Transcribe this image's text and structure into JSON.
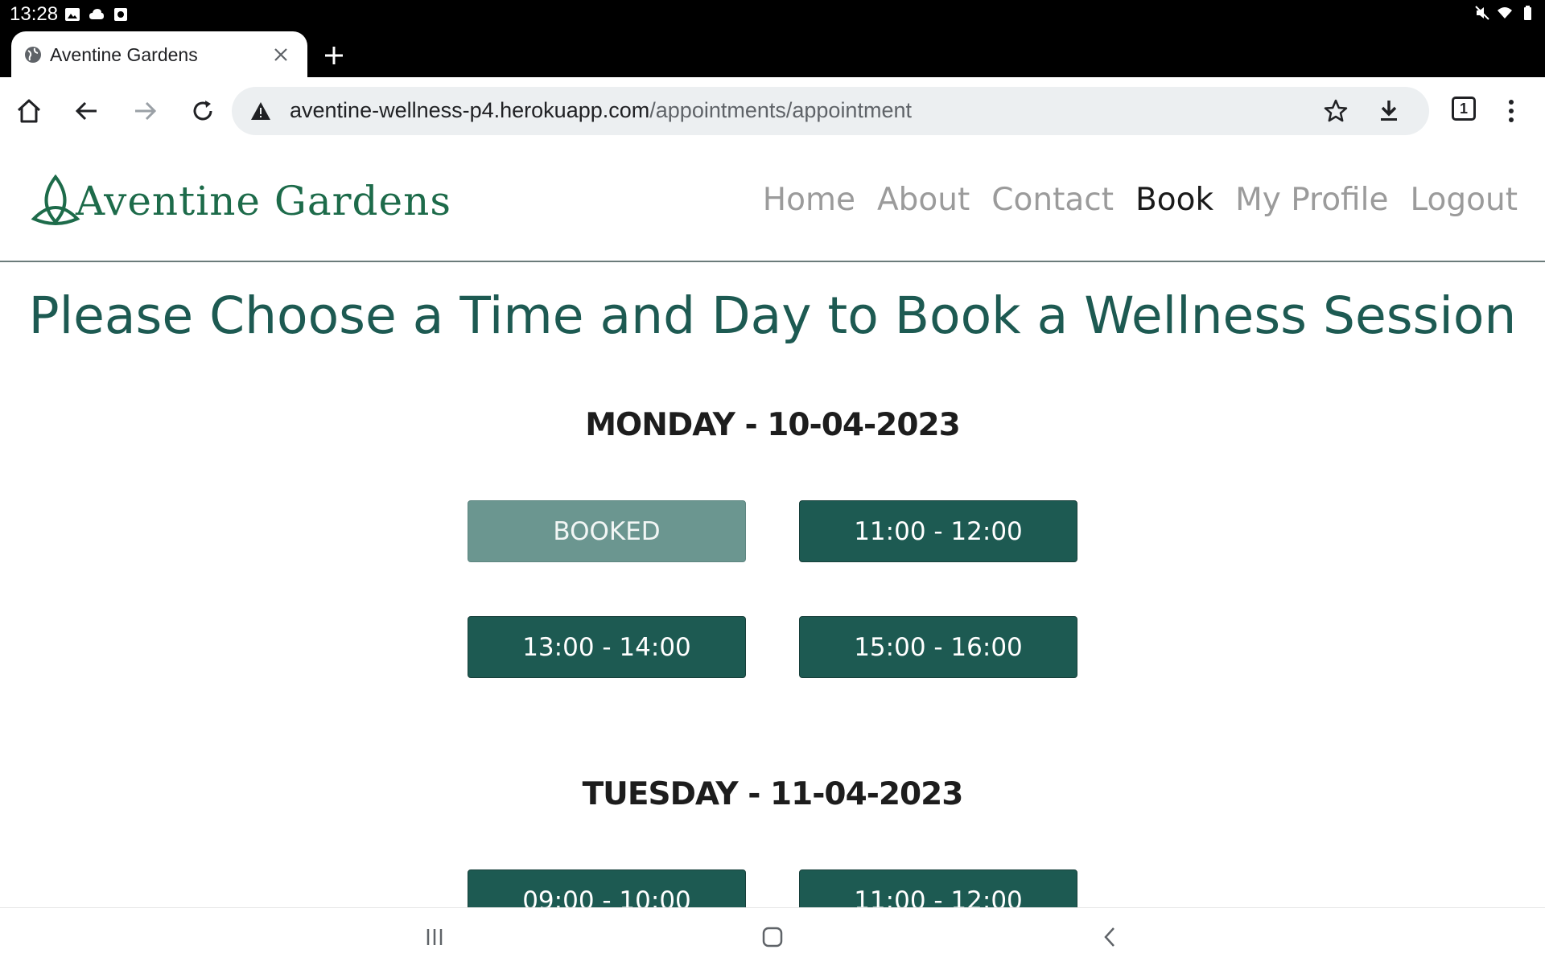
{
  "status_bar": {
    "time": "13:28"
  },
  "browser": {
    "tab_title": "Aventine Gardens",
    "url_host": "aventine-wellness-p4.herokuapp.com",
    "url_path": "/appointments/appointment",
    "tab_count": "1"
  },
  "site": {
    "logo_text": "Aventine Gardens",
    "nav": [
      {
        "label": "Home",
        "active": false
      },
      {
        "label": "About",
        "active": false
      },
      {
        "label": "Contact",
        "active": false
      },
      {
        "label": "Book",
        "active": true
      },
      {
        "label": "My Profile",
        "active": false
      },
      {
        "label": "Logout",
        "active": false
      }
    ]
  },
  "main": {
    "title": "Please Choose a Time and Day to Book a Wellness Session",
    "days": [
      {
        "heading": "MONDAY - 10-04-2023",
        "slots": [
          {
            "label": "BOOKED",
            "booked": true
          },
          {
            "label": "11:00 - 12:00",
            "booked": false
          },
          {
            "label": "13:00 - 14:00",
            "booked": false
          },
          {
            "label": "15:00 - 16:00",
            "booked": false
          }
        ]
      },
      {
        "heading": "TUESDAY - 11-04-2023",
        "slots": [
          {
            "label": "09:00 - 10:00",
            "booked": false
          },
          {
            "label": "11:00 - 12:00",
            "booked": false
          }
        ]
      }
    ]
  },
  "colors": {
    "brand": "#1d5a52",
    "booked": "#6b9690",
    "logo": "#1d6b4a"
  }
}
